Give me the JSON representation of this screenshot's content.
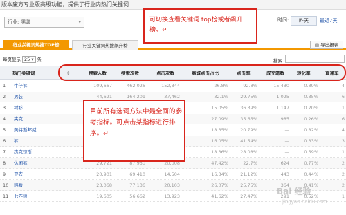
{
  "top_bar_text": "版本魔方专业版高级功能，提供了行业内热门关键词...",
  "filters": {
    "industry_label": "行业:",
    "industry_value": "男装",
    "time_label": "时间:",
    "yesterday_label": "昨天",
    "last7_label": "最近7天"
  },
  "tabs": [
    {
      "label": "行业关键词热搜TOP榜",
      "active": true
    },
    {
      "label": "行业关键词热搜飙升榜",
      "active": false
    }
  ],
  "export_label": "导出报表",
  "per_page": {
    "prefix": "每页显示",
    "value": "25",
    "suffix": "条"
  },
  "search_label": "搜索",
  "table": {
    "columns": [
      "热门关键词",
      "搜索人数",
      "搜索次数",
      "点击次数",
      "商城点击占比",
      "点击率",
      "成交笔数",
      "转化率",
      "直通车"
    ],
    "rows": [
      {
        "idx": "1",
        "kw": "牛仔裤",
        "v": [
          "109,667",
          "462,026",
          "152,344",
          "26.8%",
          "92.8%",
          "15,430",
          "0.89%",
          "4"
        ]
      },
      {
        "idx": "2",
        "kw": "男装",
        "v": [
          "44,621",
          "164,201",
          "37,462",
          "32.1%",
          "29.75%",
          "1,025",
          "0.35%",
          "6"
        ]
      },
      {
        "idx": "3",
        "kw": "衬衫",
        "v": [
          "—",
          "—",
          "—",
          "15.05%",
          "36.39%",
          "1,147",
          "0.20%",
          "1"
        ]
      },
      {
        "idx": "4",
        "kw": "夹克",
        "v": [
          "—",
          "—",
          "—",
          "27.09%",
          "35.65%",
          "985",
          "0.26%",
          "6"
        ]
      },
      {
        "idx": "5",
        "kw": "美特斯邦威",
        "v": [
          "—",
          "—",
          "—",
          "18.35%",
          "20.79%",
          "—",
          "0.82%",
          "4"
        ]
      },
      {
        "idx": "6",
        "kw": "裤",
        "v": [
          "—",
          "—",
          "—",
          "16.05%",
          "41.54%",
          "—",
          "0.33%",
          "3"
        ]
      },
      {
        "idx": "7",
        "kw": "杰克琼斯",
        "v": [
          "—",
          "—",
          "—",
          "18.36%",
          "28.08%",
          "—",
          "0.59%",
          "1"
        ]
      },
      {
        "idx": "8",
        "kw": "休闲裤",
        "v": [
          "29,721",
          "87,950",
          "20,008",
          "47.42%",
          "22.7%",
          "624",
          "0.77%",
          "2"
        ]
      },
      {
        "idx": "9",
        "kw": "卫衣",
        "v": [
          "20,901",
          "69,410",
          "14,504",
          "16.34%",
          "21.12%",
          "443",
          "0.44%",
          "2"
        ]
      },
      {
        "idx": "10",
        "kw": "韩版",
        "v": [
          "23,068",
          "77,136",
          "20,103",
          "26.07%",
          "25.75%",
          "364",
          "0.41%",
          "2"
        ]
      },
      {
        "idx": "11",
        "kw": "七匹狼",
        "v": [
          "19,605",
          "56,662",
          "13,923",
          "41.62%",
          "27.47%",
          "291",
          "0.52%",
          "1"
        ]
      }
    ]
  },
  "annotations": {
    "top_note": "可切换查看关键词 top榜或者飙升榜。↵",
    "mid_note": "目前所有选词方法中最全面的参考指标。可点击某指标进行排序。↵"
  },
  "watermark": {
    "text": "Bai 经验",
    "url": "jingyan.baidu.com"
  },
  "colors": {
    "accent": "#f39800",
    "annotation": "#d9251c",
    "link": "#2255aa"
  }
}
